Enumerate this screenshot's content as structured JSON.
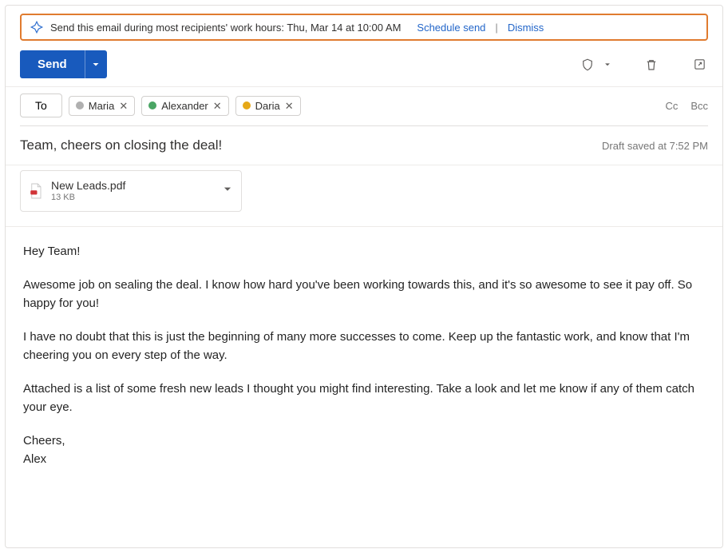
{
  "banner": {
    "text": "Send this email during most recipients' work hours: Thu, Mar 14 at 10:00 AM",
    "schedule_label": "Schedule send",
    "dismiss_label": "Dismiss"
  },
  "toolbar": {
    "send_label": "Send"
  },
  "address": {
    "to_label": "To",
    "cc_label": "Cc",
    "bcc_label": "Bcc",
    "recipients": [
      {
        "name": "Maria",
        "presence": "away",
        "color": "#b0b0b0"
      },
      {
        "name": "Alexander",
        "presence": "online",
        "color": "#4aa564"
      },
      {
        "name": "Daria",
        "presence": "busy",
        "color": "#e6a817"
      }
    ]
  },
  "subject": "Team, cheers on closing the deal!",
  "draft_saved": "Draft saved at 7:52 PM",
  "attachment": {
    "name": "New Leads.pdf",
    "size": "13 KB"
  },
  "body": {
    "greeting": "Hey Team!",
    "p1": "Awesome job on sealing the deal. I know how hard you've been working towards this, and it's so awesome to see it pay off. So happy for you!",
    "p2": "I have no doubt that this is just the beginning of many more successes to come. Keep up the fantastic work, and know that I'm cheering you on every step of the way.",
    "p3": "Attached is a list of some fresh new leads I thought you might find interesting. Take a look and let me know if any of them catch your eye.",
    "signoff": "Cheers,",
    "signature": "Alex"
  }
}
